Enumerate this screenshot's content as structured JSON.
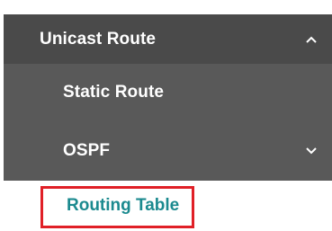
{
  "nav": {
    "parent": {
      "label": "Unicast Route",
      "icon": "chevron-up-icon",
      "expanded": true
    },
    "children": [
      {
        "label": "Static Route"
      },
      {
        "label": "OSPF",
        "icon": "chevron-down-icon",
        "expanded": false
      }
    ],
    "active_item": {
      "label": "Routing Table"
    }
  },
  "colors": {
    "parent_bg": "#4a4a4a",
    "child_bg": "#595959",
    "text_light": "#ffffff",
    "active_text": "#1b8a8f",
    "highlight_border": "#e02027"
  }
}
